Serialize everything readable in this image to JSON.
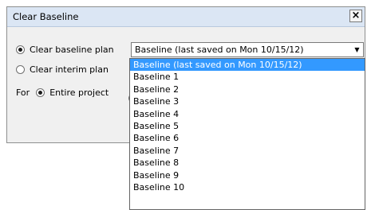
{
  "dialog": {
    "title": "Clear Baseline",
    "close_label": "×",
    "options": {
      "clear_baseline_label": "Clear baseline plan",
      "clear_interim_label": "Clear interim plan",
      "for_label": "For",
      "entire_project_label": "Entire project"
    },
    "baseline_select": {
      "selected_value": "Baseline (last saved on Mon 10/15/12)",
      "arrow_icon": "chevron-down-icon"
    },
    "dropdown_items": [
      "Baseline (last saved on Mon 10/15/12)",
      "Baseline 1",
      "Baseline 2",
      "Baseline 3",
      "Baseline 4",
      "Baseline 5",
      "Baseline 6",
      "Baseline 7",
      "Baseline 8",
      "Baseline 9",
      "Baseline 10"
    ]
  },
  "colors": {
    "selection": "#3399ff",
    "titlebar": "#dbe6f4"
  }
}
